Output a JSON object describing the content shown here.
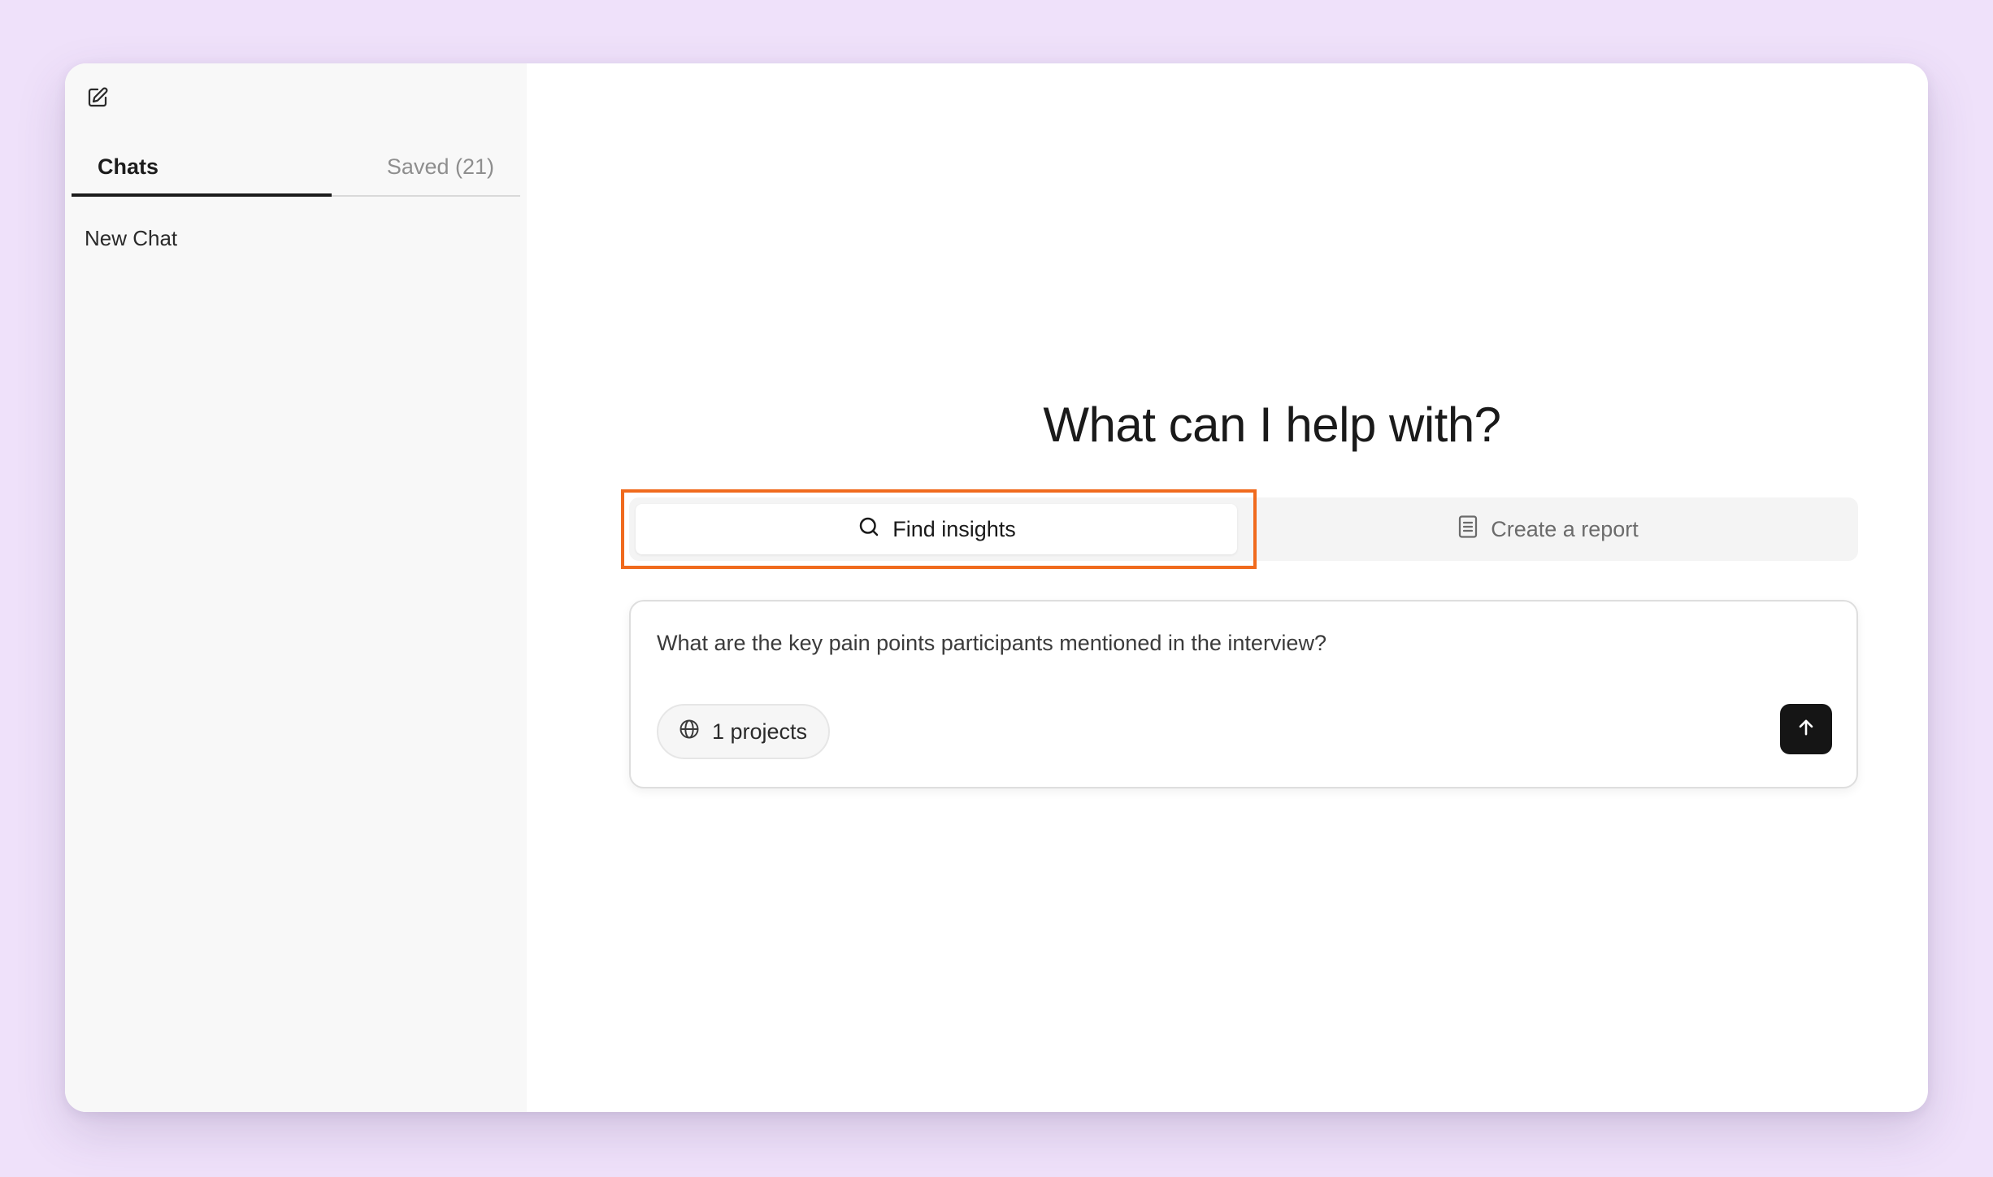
{
  "sidebar": {
    "tabs": [
      {
        "label": "Chats",
        "active": true
      },
      {
        "label": "Saved (21)",
        "active": false
      }
    ],
    "chats": [
      {
        "label": "New Chat"
      }
    ]
  },
  "main": {
    "heading": "What can I help with?",
    "modes": [
      {
        "label": "Find insights",
        "icon": "search-icon",
        "active": true
      },
      {
        "label": "Create a report",
        "icon": "document-icon",
        "active": false
      }
    ],
    "composer": {
      "value": "What are the key pain points participants mentioned in the interview?",
      "projects_chip": "1 projects"
    }
  },
  "colors": {
    "background": "#efe1fa",
    "highlight": "#f06a1d",
    "send_button": "#151515"
  }
}
